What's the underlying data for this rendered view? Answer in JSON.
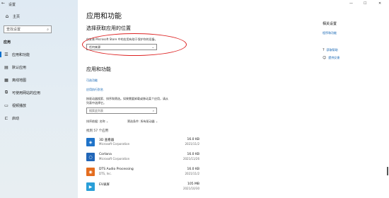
{
  "window": {
    "title": "设置",
    "controls": [
      "—",
      "☐",
      "✕"
    ]
  },
  "sidebar": {
    "home": "主页",
    "search_placeholder": "查找设置",
    "section": "应用",
    "items": [
      {
        "label": "应用和功能",
        "icon": "app-list-icon"
      },
      {
        "label": "默认应用",
        "icon": "default-apps-icon"
      },
      {
        "label": "离线地图",
        "icon": "map-icon"
      },
      {
        "label": "可使用网站的应用",
        "icon": "website-apps-icon"
      },
      {
        "label": "视频播放",
        "icon": "video-icon"
      },
      {
        "label": "启动",
        "icon": "startup-icon"
      }
    ]
  },
  "main": {
    "title": "应用和功能",
    "choose_title": "选择获取应用的位置",
    "choose_desc": "仅安装 Microsoft Store 中的应用有助于保护你的设备。",
    "choose_value": "任何来源",
    "apps_title": "应用和功能",
    "link_optional": "可选功能",
    "link_alias": "应用执行别名",
    "search_desc_1": "按驱动器搜索、排序和筛选。如果需要卸载或移动某个应用，请从",
    "search_desc_2": "列表中选择它。",
    "search_placeholder": "搜索此列表",
    "sort_label": "排序依据: 名称",
    "filter_label": "筛选条件: 所有驱动器",
    "found_count": "找到 57 个应用",
    "apps": [
      {
        "name": "3D 查看器",
        "publisher": "Microsoft Corporation",
        "size": "16.0 KB",
        "date": "2021/11/2",
        "icon_color": "#1f73c9",
        "icon": "3d-viewer-icon"
      },
      {
        "name": "Cortana",
        "publisher": "Microsoft Corporation",
        "size": "16.0 KB",
        "date": "2021/11/26",
        "icon_color": "#2166b8",
        "icon": "cortana-icon"
      },
      {
        "name": "DTS Audio Processing",
        "publisher": "DTS, Inc.",
        "size": "16.0 KB",
        "date": "2021/11/2",
        "icon_color": "#e46d1f",
        "icon": "dts-audio-icon"
      },
      {
        "name": "EV录屏",
        "publisher": "",
        "size": "105 MB",
        "date": "2021/10/30",
        "icon_color": "#2a9fd8",
        "icon": "ev-recorder-icon"
      }
    ]
  },
  "right": {
    "title": "相关设置",
    "link": "程序和功能",
    "help": "获取帮助",
    "feedback": "提供反馈"
  }
}
